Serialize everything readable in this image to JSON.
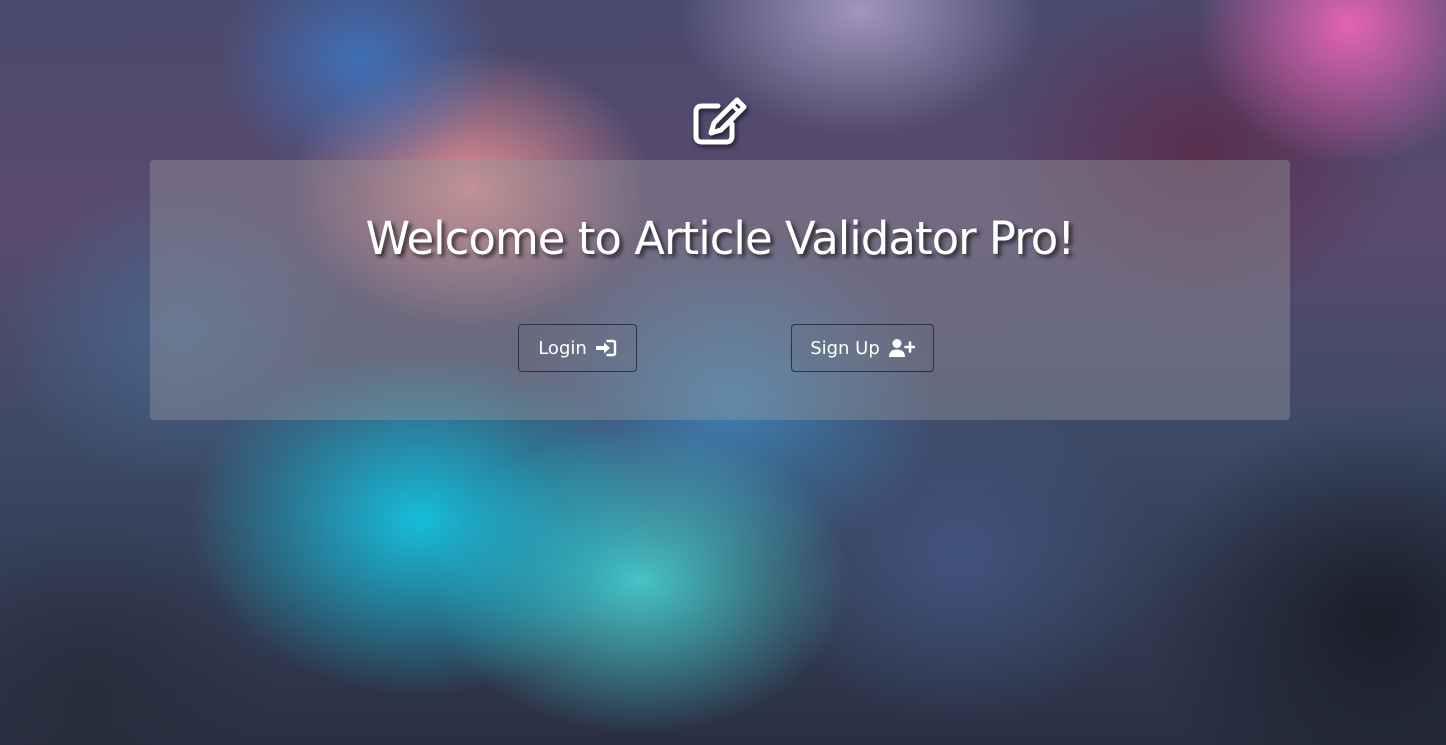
{
  "header": {
    "logo_icon": "edit-square-icon"
  },
  "welcome": {
    "title": "Welcome to Article Validator Pro!"
  },
  "actions": {
    "login": {
      "label": "Login",
      "icon": "sign-in-icon"
    },
    "signup": {
      "label": "Sign Up",
      "icon": "user-plus-icon"
    }
  }
}
